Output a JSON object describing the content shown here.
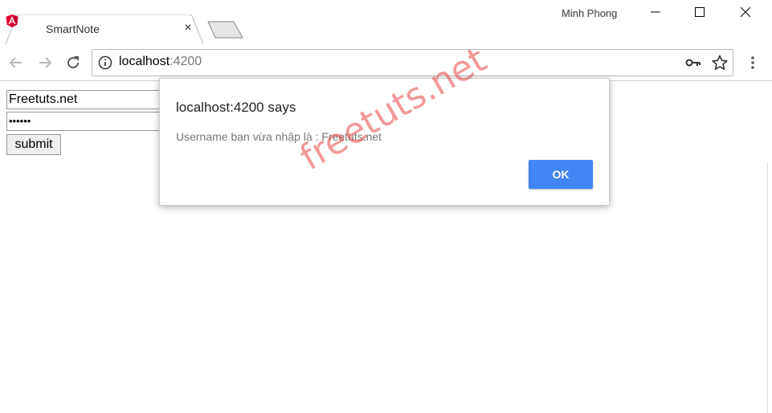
{
  "browser": {
    "tab_title": "SmartNote",
    "tab_close": "×",
    "profile_name": "Minh Phong",
    "url_host": "localhost",
    "url_port": ":4200",
    "icons": {
      "favicon": "angular-icon",
      "back": "arrow-left-icon",
      "forward": "arrow-right-icon",
      "reload": "reload-icon",
      "info": "info-icon",
      "key": "key-icon",
      "star": "star-icon",
      "menu": "vertical-dots-icon"
    }
  },
  "form": {
    "username_value": "Freetuts.net",
    "password_value": "••••••",
    "submit_label": "submit"
  },
  "dialog": {
    "title": "localhost:4200 says",
    "message": "Username bạn vừa nhập là : Freetuts.net",
    "ok_label": "OK",
    "ok_color": "#4285f4"
  },
  "watermark": "freetuts.net"
}
